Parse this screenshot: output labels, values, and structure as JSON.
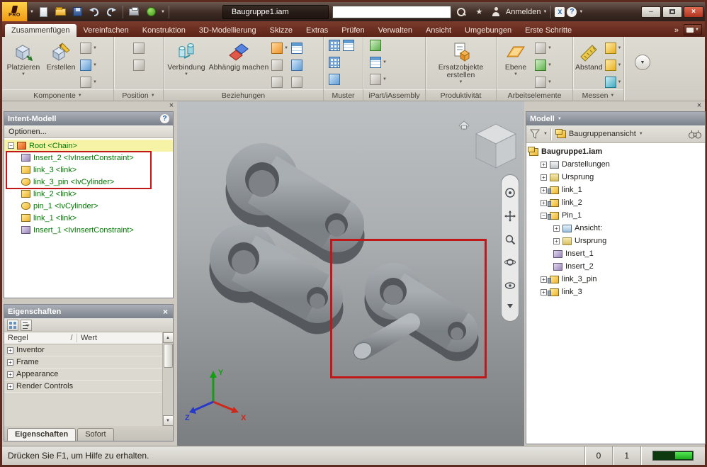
{
  "colors": {
    "selection_box_red": "#c01818",
    "intent_tree_text_green": "#007a00",
    "root_row_highlight_yellow": "#f6f3a6",
    "status_indicator_green": "#33cc33",
    "ribbon_background": "#d9d6ce",
    "titlebar_background": "#3d2b24"
  },
  "icons": {
    "caret_down": "▼",
    "caret_up": "▲",
    "chevron_right": "»",
    "close": "×",
    "minimize": "–",
    "help": "?",
    "exchange_x": "X",
    "plus": "+",
    "minus": "−",
    "slash": "/",
    "star": "★"
  },
  "titlebar": {
    "logo_text": "PRO",
    "document_title": "Baugruppe1.iam",
    "search_value": "",
    "signin_label": "Anmelden"
  },
  "ribbon": {
    "active_tab": "Zusammenfügen",
    "tabs": [
      "Zusammenfügen",
      "Vereinfachen",
      "Konstruktion",
      "3D-Modellierung",
      "Skizze",
      "Extras",
      "Prüfen",
      "Verwalten",
      "Ansicht",
      "Umgebungen",
      "Erste Schritte"
    ],
    "buttons": {
      "platzieren": "Platzieren",
      "erstellen": "Erstellen",
      "verbindung": "Verbindung",
      "abhaengig_machen": "Abhängig machen",
      "ersatzobjekte": "Ersatzobjekte erstellen",
      "ebene": "Ebene",
      "abstand": "Abstand"
    },
    "groups": [
      "Komponente",
      "Position",
      "Beziehungen",
      "Muster",
      "iPart/iAssembly",
      "Produktivität",
      "Arbeitselemente",
      "Messen"
    ]
  },
  "intent_panel": {
    "title": "Intent-Modell",
    "options_label": "Optionen...",
    "tree": [
      "Root <Chain>",
      "Insert_2 <IvInsertConstraint>",
      "link_3 <link>",
      "link_3_pin <IvCylinder>",
      "link_2 <link>",
      "pin_1 <IvCylinder>",
      "link_1 <link>",
      "Insert_1 <IvInsertConstraint>"
    ]
  },
  "properties_panel": {
    "title": "Eigenschaften",
    "column_rule": "Regel",
    "column_value": "Wert",
    "rows": [
      "Inventor",
      "Frame",
      "Appearance",
      "Render Controls"
    ],
    "tabs": [
      "Eigenschaften",
      "Sofort"
    ]
  },
  "model_panel": {
    "title": "Modell",
    "view_mode": "Baugruppenansicht",
    "tree": [
      "Baugruppe1.iam",
      "Darstellungen",
      "Ursprung",
      "link_1",
      "link_2",
      "Pin_1",
      "Ansicht:",
      "Ursprung",
      "Insert_1",
      "Insert_2",
      "link_3_pin",
      "link_3"
    ]
  },
  "viewport": {
    "axes": {
      "x": "X",
      "y": "Y",
      "z": "Z"
    }
  },
  "statusbar": {
    "message": "Drücken Sie F1, um Hilfe zu erhalten.",
    "value_a": "0",
    "value_b": "1"
  }
}
